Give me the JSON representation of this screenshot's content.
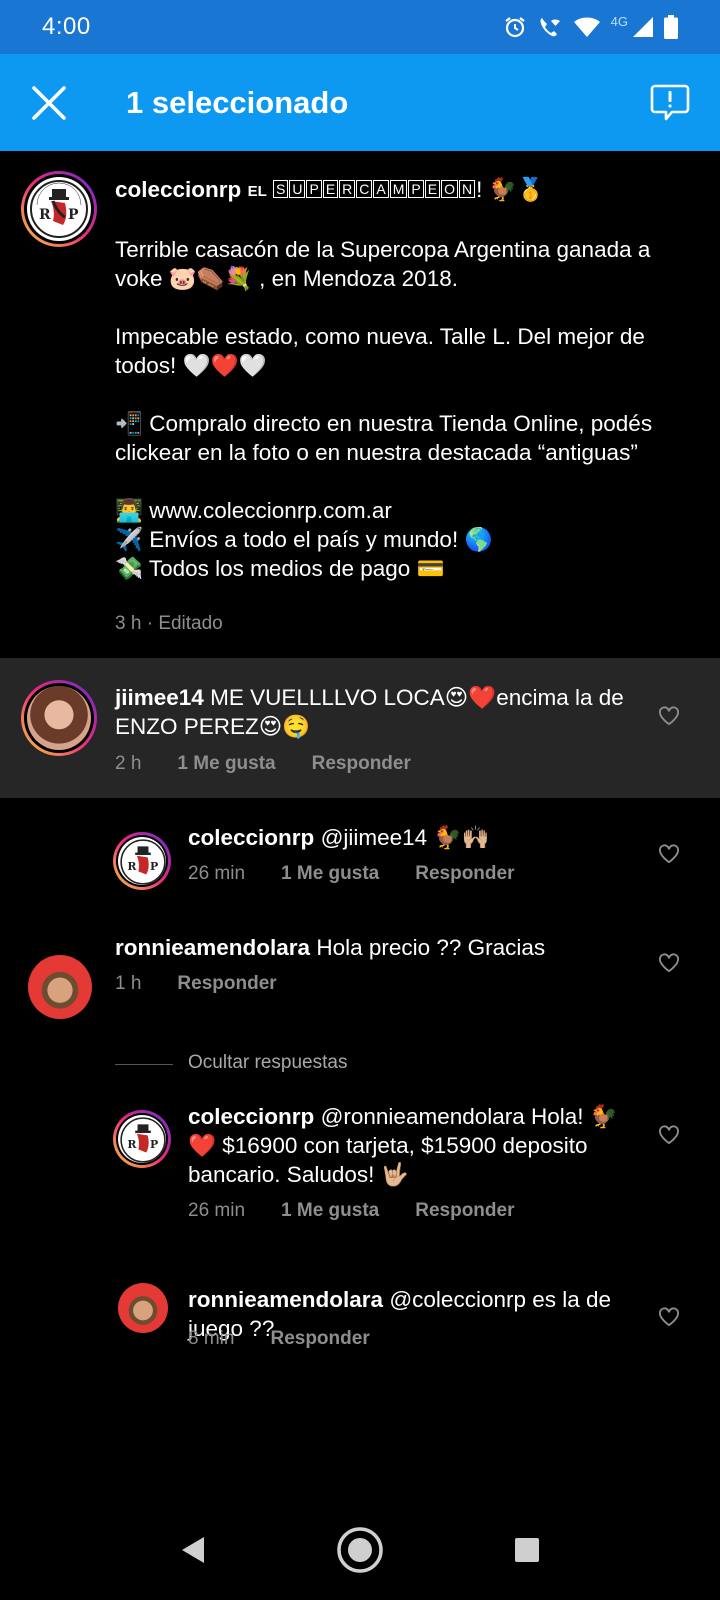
{
  "status_bar": {
    "time": "4:00",
    "network": "4G"
  },
  "header": {
    "title": "1 seleccionado"
  },
  "caption": {
    "username": "coleccionrp",
    "prefix": "EL",
    "boxed_word": [
      "S",
      "U",
      "P",
      "E",
      "R",
      "C",
      "A",
      "M",
      "P",
      "E",
      "O",
      "N"
    ],
    "line1_end": "! 🐓🥇",
    "p1": "Terrible casacón de la Supercopa Argentina ganada a voke 🐷⚰️💐 , en Mendoza 2018.",
    "p2": "Impecable estado, como nueva. Talle L. Del mejor de todos! 🤍❤️🤍",
    "p3": "📲 Compralo directo en nuestra Tienda Online, podés clickear en la foto o en nuestra destacada “antiguas”",
    "p4a": "👨‍💻 www.coleccionrp.com.ar",
    "p4b": "✈️ Envíos a todo el país y mundo! 🌎",
    "p4c": "💸 Todos los medios de pago 💳",
    "time": "3 h",
    "edited": "Editado"
  },
  "comments": [
    {
      "username": "jiimee14",
      "text": "ME VUELLLLVO LOCA😍❤️encima la de ENZO PEREZ😍🤤",
      "time": "2 h",
      "likes": "1 Me gusta",
      "reply": "Responder"
    },
    {
      "username": "coleccionrp",
      "text": "@jiimee14 🐓🙌🏼",
      "time": "26 min",
      "likes": "1 Me gusta",
      "reply": "Responder"
    },
    {
      "username": "ronnieamendolara",
      "text": "Hola precio ?? Gracias",
      "time": "1 h",
      "reply": "Responder"
    },
    {
      "username": "coleccionrp",
      "text": "@ronnieamendolara Hola! 🐓❤️ $16900 con tarjeta, $15900 deposito bancario. Saludos! 🤟🏼",
      "time": "26 min",
      "likes": "1 Me gusta",
      "reply": "Responder"
    },
    {
      "username": "ronnieamendolara",
      "text": "@coleccionrp es la de juego ??",
      "time": "8 min",
      "reply": "Responder"
    }
  ],
  "hide_replies": "Ocultar respuestas",
  "logo_text": "COLECCIÓN RP",
  "colors": {
    "status_bar": "#1976d2",
    "action_bar": "#0d99f2",
    "selected_row": "#262626",
    "meta_gray": "#8e8e8e"
  }
}
